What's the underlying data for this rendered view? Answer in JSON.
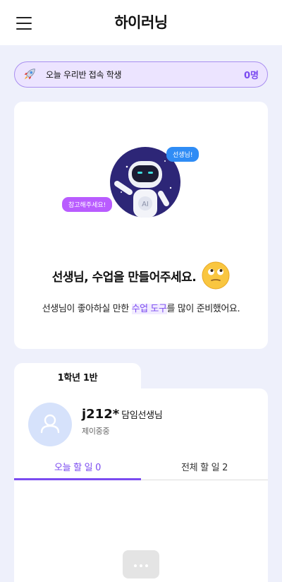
{
  "header": {
    "title": "하이러닝"
  },
  "banner": {
    "text": "오늘 우리반 접속 학생",
    "count": "0명"
  },
  "hero": {
    "bubble_right": "선생님!",
    "bubble_left": "참고해주세요!",
    "robot_badge": "AI",
    "title": "선생님, 수업을 만들어주세요.",
    "desc_before": "선생님이 좋아하실 만한 ",
    "desc_highlight": "수업 도구",
    "desc_after": "를 많이 준비했어요."
  },
  "class": {
    "tab_label": "1학년 1반",
    "user_name": "j212*",
    "user_role": "담임선생님",
    "school": "제이중중",
    "tabs": [
      {
        "label": "오늘 할 일 0"
      },
      {
        "label": "전체 할 일 2"
      }
    ]
  },
  "colors": {
    "accent": "#7b4bf0",
    "background": "#eef0fb",
    "bubble_blue": "#2f8cf5",
    "bubble_purple": "#b95cff"
  },
  "icons": [
    "menu-icon",
    "rocket-icon",
    "ai-robot-illustration",
    "thinking-face-icon",
    "user-avatar-icon",
    "empty-state-icon"
  ]
}
